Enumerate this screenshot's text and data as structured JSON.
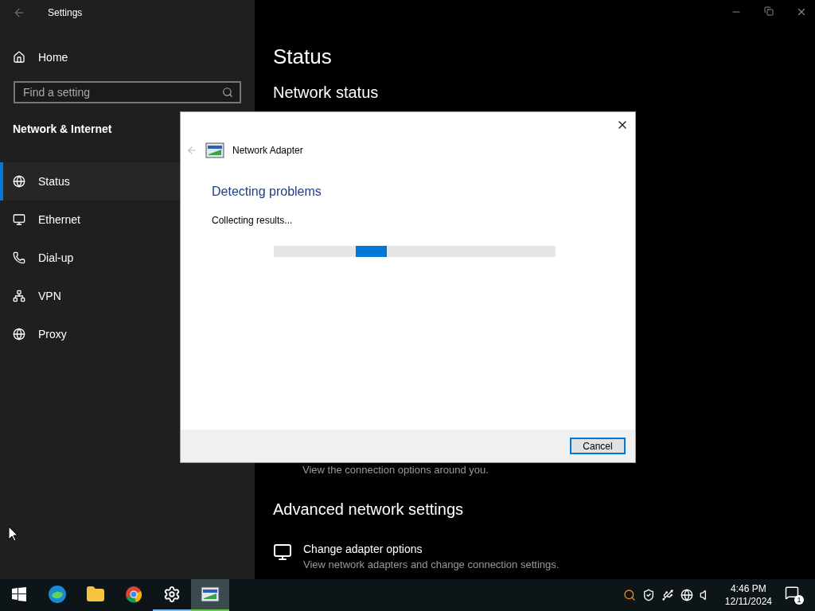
{
  "window": {
    "title": "Settings"
  },
  "sidebar": {
    "home": "Home",
    "search": {
      "placeholder": "Find a setting"
    },
    "section": "Network & Internet",
    "items": [
      {
        "label": "Status",
        "kind": "status",
        "selected": true
      },
      {
        "label": "Ethernet",
        "kind": "ethernet",
        "selected": false
      },
      {
        "label": "Dial-up",
        "kind": "dialup",
        "selected": false
      },
      {
        "label": "VPN",
        "kind": "vpn",
        "selected": false
      },
      {
        "label": "Proxy",
        "kind": "proxy",
        "selected": false
      }
    ]
  },
  "main": {
    "title": "Status",
    "network_status": "Network status",
    "partial_caption": "View the connection options around you.",
    "advanced": {
      "heading": "Advanced network settings",
      "items": [
        {
          "title": "Change adapter options",
          "description": "View network adapters and change connection settings."
        }
      ]
    }
  },
  "dialog": {
    "title": "Network Adapter",
    "heading": "Detecting problems",
    "status": "Collecting results...",
    "progress": {
      "level": 0.4
    },
    "buttons": [
      "Cancel"
    ]
  },
  "taskbar": {
    "apps": [
      {
        "kind": "edge",
        "open": false,
        "selected": false
      },
      {
        "kind": "explorer",
        "open": false,
        "selected": false
      },
      {
        "kind": "chrome",
        "open": false,
        "selected": false
      },
      {
        "kind": "settings",
        "open": true,
        "selected": false
      },
      {
        "kind": "troubleshooter",
        "open": true,
        "selected": true
      }
    ],
    "time": "4:46 PM",
    "date": "12/11/2024",
    "notifications": "1"
  }
}
